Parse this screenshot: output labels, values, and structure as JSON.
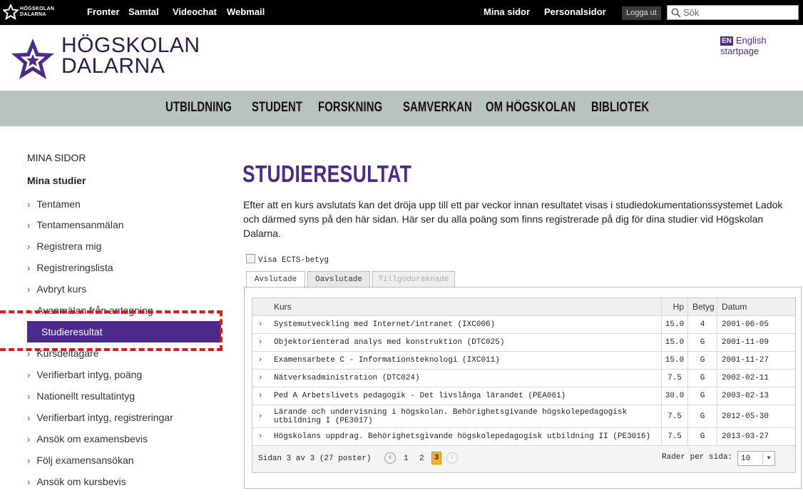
{
  "topbar": {
    "logo_line1": "HÖGSKOLAN",
    "logo_line2": "DALARNA",
    "links": [
      "Fronter",
      "Samtal",
      "Videochat",
      "Webmail"
    ],
    "right_links": [
      "Mina sidor",
      "Personalsidor"
    ],
    "logout": "Logga ut",
    "search_placeholder": "Sök"
  },
  "header": {
    "logo_line1": "HÖGSKOLAN",
    "logo_line2": "DALARNA",
    "english_badge": "EN",
    "english_label": "English startpage"
  },
  "nav": [
    "UTBILDNING",
    "STUDENT",
    "FORSKNING",
    "SAMVERKAN",
    "OM HÖGSKOLAN",
    "BIBLIOTEK"
  ],
  "sidebar": {
    "heading": "MINA SIDOR",
    "subheading": "Mina studier",
    "items": [
      "Tentamen",
      "Tentamensanmälan",
      "Registrera mig",
      "Registreringslista",
      "Avbryt kurs",
      "Avanmälan från antagning",
      "Studieresultat",
      "Kursdeltagare",
      "Verifierbart intyg, poäng",
      "Nationellt resultatintyg",
      "Verifierbart intyg, registreringar",
      "Ansök om examensbevis",
      "Följ examensansökan",
      "Ansök om kursbevis"
    ]
  },
  "content": {
    "title": "STUDIERESULTAT",
    "intro": "Efter att en kurs avslutats kan det dröja upp till ett par veckor innan resultatet visas i studiedokumentationssystemet Ladok och därmed syns på den här sidan. Här ser du alla poäng som finns registrerade på dig för dina studier vid Högskolan Dalarna.",
    "ects_label": "Visa ECTS-betyg",
    "tabs": [
      "Avslutade",
      "Oavslutade",
      "Tillgodoräknade"
    ]
  },
  "table": {
    "columns": [
      "Kurs",
      "Hp",
      "Betyg",
      "Datum"
    ],
    "rows": [
      {
        "kurs": "Systemutveckling med Internet/intranet (IXC006)",
        "hp": "15.0",
        "betyg": "4",
        "datum": "2001-06-05"
      },
      {
        "kurs": "Objektorienterad analys med konstruktion (DTC025)",
        "hp": "15.0",
        "betyg": "G",
        "datum": "2001-11-09"
      },
      {
        "kurs": "Examensarbete C - Informationsteknologi (IXC011)",
        "hp": "15.0",
        "betyg": "G",
        "datum": "2001-11-27"
      },
      {
        "kurs": "Nätverksadministration (DTC024)",
        "hp": "7.5",
        "betyg": "G",
        "datum": "2002-02-11"
      },
      {
        "kurs": "Ped A Arbetslivets pedagogik - Det livslånga lärandet (PEA061)",
        "hp": "30.0",
        "betyg": "G",
        "datum": "2003-02-13"
      },
      {
        "kurs": "Lärande och undervisning i högskolan. Behörighetsgivande högskolepedagogisk utbildning I (PE3017)",
        "hp": "7.5",
        "betyg": "G",
        "datum": "2012-05-30"
      },
      {
        "kurs": "Högskolans uppdrag. Behörighetsgivande högskolepedagogisk utbildning II (PE3016)",
        "hp": "7.5",
        "betyg": "G",
        "datum": "2013-03-27"
      }
    ],
    "pager": {
      "info": "Sidan 3 av 3 (27 poster)",
      "pages": [
        "1",
        "2"
      ],
      "current": "3",
      "rows_per_page_label": "Rader per sida:",
      "rows_per_page": "10"
    }
  },
  "colors": {
    "brand": "#4b2a8c",
    "nav_bg": "#b8c2bf",
    "highlight": "#e8141c",
    "pager_current": "#f5b32d"
  }
}
